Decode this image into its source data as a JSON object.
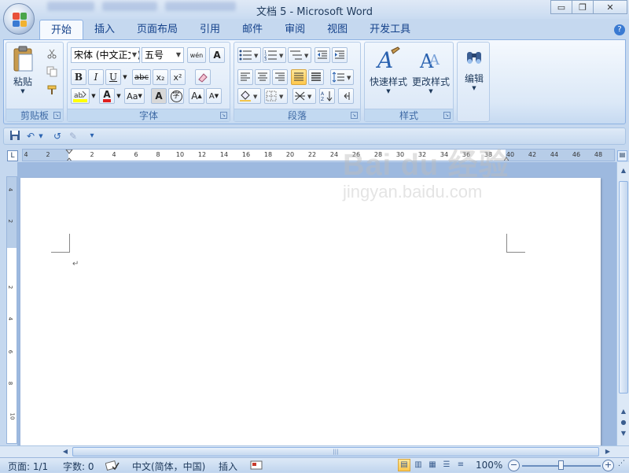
{
  "window": {
    "title": "文档 5 - Microsoft Word",
    "minimize_glyph": "▭",
    "restore_glyph": "❐",
    "close_glyph": "✕"
  },
  "ribbon_tabs": [
    {
      "label": "开始",
      "active": true
    },
    {
      "label": "插入"
    },
    {
      "label": "页面布局"
    },
    {
      "label": "引用"
    },
    {
      "label": "邮件"
    },
    {
      "label": "审阅"
    },
    {
      "label": "视图"
    },
    {
      "label": "开发工具"
    }
  ],
  "help_glyph": "?",
  "clipboard": {
    "group_label": "剪贴板",
    "paste_label": "粘贴"
  },
  "font": {
    "group_label": "字体",
    "font_name": "宋体 (中文正文)",
    "font_size": "五号",
    "phonetic_glyph": "wén",
    "bold": "B",
    "italic": "I",
    "underline": "U",
    "strike": "abc",
    "subscript": "x₂",
    "superscript": "x²",
    "font_color_glyph": "A",
    "change_case": "Aa",
    "char_shading": "A",
    "enclose": "字",
    "grow_font": "A",
    "shrink_font": "A"
  },
  "paragraph": {
    "group_label": "段落"
  },
  "styles": {
    "group_label": "样式",
    "quick_styles_label": "快速样式",
    "change_styles_label": "更改样式"
  },
  "editing": {
    "label": "编辑"
  },
  "ruler": {
    "h_ticks": [
      "4",
      "2",
      "2",
      "4",
      "6",
      "8",
      "10",
      "12",
      "14",
      "16",
      "18",
      "20",
      "22",
      "24",
      "26",
      "28",
      "30",
      "32",
      "34",
      "36",
      "38",
      "40",
      "42",
      "44",
      "46",
      "48"
    ],
    "v_ticks": [
      "4",
      "2",
      "2",
      "4",
      "6",
      "8",
      "10"
    ],
    "tab_selector_glyph": "L"
  },
  "document": {
    "paragraph_mark": "↵"
  },
  "status": {
    "page": "页面: 1/1",
    "words": "字数: 0",
    "language": "中文(简体，中国)",
    "mode": "插入",
    "zoom": "100%",
    "zoom_level_percent": 100
  },
  "watermark": {
    "brand": "Bai du 经验",
    "url": "jingyan.baidu.com"
  }
}
